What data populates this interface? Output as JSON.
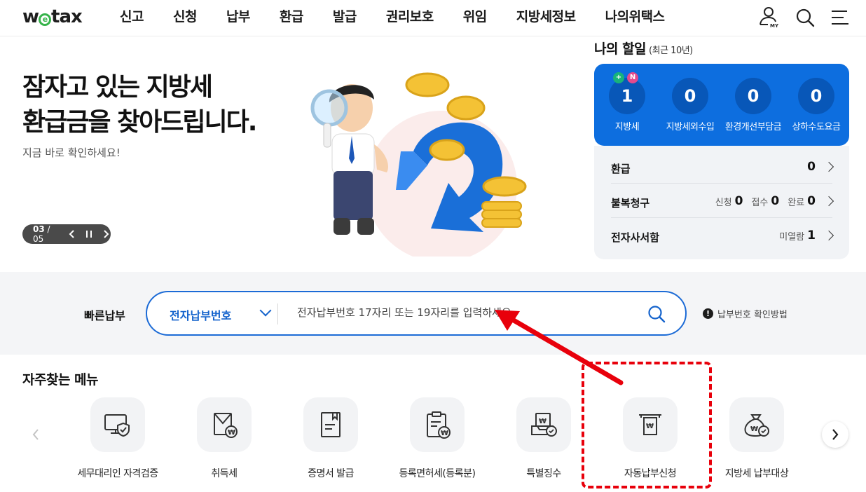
{
  "header": {
    "logo_text_a": "w",
    "logo_text_b": "tax",
    "logo_e": "e",
    "nav": [
      "신고",
      "신청",
      "납부",
      "환급",
      "발급",
      "권리보호",
      "위임",
      "지방세정보",
      "나의위택스"
    ],
    "icons": [
      "my-account-icon",
      "search-icon",
      "hamburger-menu-icon"
    ],
    "my_badge": "MY"
  },
  "banner": {
    "title_line1": "잠자고 있는 지방세",
    "title_line2": "환급금을 찾아드립니다.",
    "subtitle": "지금 바로 확인하세요!",
    "pager_current": "03",
    "pager_total": "/ 05"
  },
  "my_tax": {
    "title": "나의 할일",
    "period": "(최근 10년)",
    "stats": [
      {
        "value": "1",
        "label": "지방세",
        "badges": [
          "+",
          "N"
        ]
      },
      {
        "value": "0",
        "label": "지방세외수입"
      },
      {
        "value": "0",
        "label": "환경개선부담금"
      },
      {
        "value": "0",
        "label": "상하수도요금"
      }
    ],
    "refund": {
      "label": "환급",
      "value": "0"
    },
    "objection": {
      "label": "불복청구",
      "apply_label": "신청",
      "apply_value": "0",
      "receive_label": "접수",
      "receive_value": "0",
      "done_label": "완료",
      "done_value": "0"
    },
    "edoc": {
      "label": "전자사서함",
      "unread_label": "미열람",
      "unread_value": "1"
    }
  },
  "quick_pay": {
    "label": "빠른납부",
    "select_value": "전자납부번호",
    "placeholder": "전자납부번호 17자리 또는 19자리를 입력하세요",
    "help_text": "납부번호 확인방법"
  },
  "frequent": {
    "title": "자주찾는 메뉴",
    "items": [
      {
        "label": "세무대리인 자격검증",
        "icon": "monitor-shield-icon"
      },
      {
        "label": "취득세",
        "icon": "envelope-won-icon"
      },
      {
        "label": "증명서 발급",
        "icon": "document-bookmark-icon"
      },
      {
        "label": "등록면허세(등록분)",
        "icon": "clipboard-won-icon"
      },
      {
        "label": "특별징수",
        "icon": "tray-check-icon"
      },
      {
        "label": "자동납부신청",
        "icon": "atm-receipt-icon"
      },
      {
        "label": "지방세 납부대상",
        "icon": "money-bag-check-icon"
      }
    ]
  },
  "colors": {
    "primary": "#0d6edf",
    "primary_dark": "#0857b8",
    "annotation": "#e8000b",
    "logo_green": "#36b34a"
  }
}
